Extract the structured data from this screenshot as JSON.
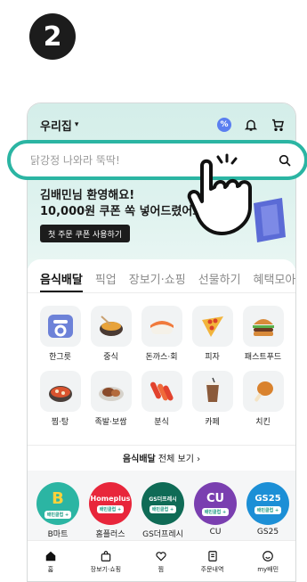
{
  "step": "2",
  "header": {
    "address": "우리집",
    "address_caret": "▾",
    "badge_icon": "%"
  },
  "search": {
    "placeholder": "닭강정 나와라 뚝딱!"
  },
  "greeting": {
    "line1": "김배민님 환영해요!",
    "line2": "10,000원 쿠폰 쏙 넣어드렸어요"
  },
  "coupon_button": "첫 주문 쿠폰 사용하기",
  "tabs": [
    {
      "label": "음식배달",
      "active": true
    },
    {
      "label": "픽업",
      "active": false
    },
    {
      "label": "장보기·쇼핑",
      "active": false
    },
    {
      "label": "선물하기",
      "active": false
    },
    {
      "label": "혜택모아",
      "active": false
    }
  ],
  "categories": [
    {
      "label": "한그릇",
      "icon": "hangeureut-icon"
    },
    {
      "label": "중식",
      "icon": "chinese-icon"
    },
    {
      "label": "돈까스·회",
      "icon": "sushi-icon"
    },
    {
      "label": "피자",
      "icon": "pizza-icon"
    },
    {
      "label": "패스트푸드",
      "icon": "burger-icon"
    },
    {
      "label": "찜·탕",
      "icon": "stew-icon"
    },
    {
      "label": "족발·보쌈",
      "icon": "jokbal-icon"
    },
    {
      "label": "분식",
      "icon": "tteokbokki-icon"
    },
    {
      "label": "카페",
      "icon": "cafe-icon"
    },
    {
      "label": "치킨",
      "icon": "chicken-icon"
    }
  ],
  "see_all": {
    "bold": "음식배달",
    "rest": " 전체 보기 ›"
  },
  "stores": [
    {
      "name": "B마트",
      "logo_text": "B",
      "tag": "배민클럽 +",
      "color": "#2bb5a3"
    },
    {
      "name": "홈플러스",
      "logo_text": "Homeplus",
      "tag": "배민클럽 +",
      "color": "#e8263b"
    },
    {
      "name": "GS더프레시",
      "logo_text": "GS더프레시",
      "tag": "배민클럽 +",
      "color": "#0f6b56"
    },
    {
      "name": "CU",
      "logo_text": "CU",
      "tag": "배민클럽 +",
      "color": "#7a3fb0"
    },
    {
      "name": "GS25",
      "logo_text": "GS25",
      "tag": "배민클럽 +",
      "color": "#1c8fd6"
    }
  ],
  "bottom_nav": [
    {
      "label": "홈",
      "icon": "home-icon"
    },
    {
      "label": "장보기·쇼핑",
      "icon": "shopping-bag-icon"
    },
    {
      "label": "찜",
      "icon": "heart-icon"
    },
    {
      "label": "주문내역",
      "icon": "receipt-icon"
    },
    {
      "label": "my배민",
      "icon": "profile-icon"
    }
  ],
  "colors": {
    "accent": "#2bb5a3",
    "hero_bg": "#d4eee9"
  }
}
